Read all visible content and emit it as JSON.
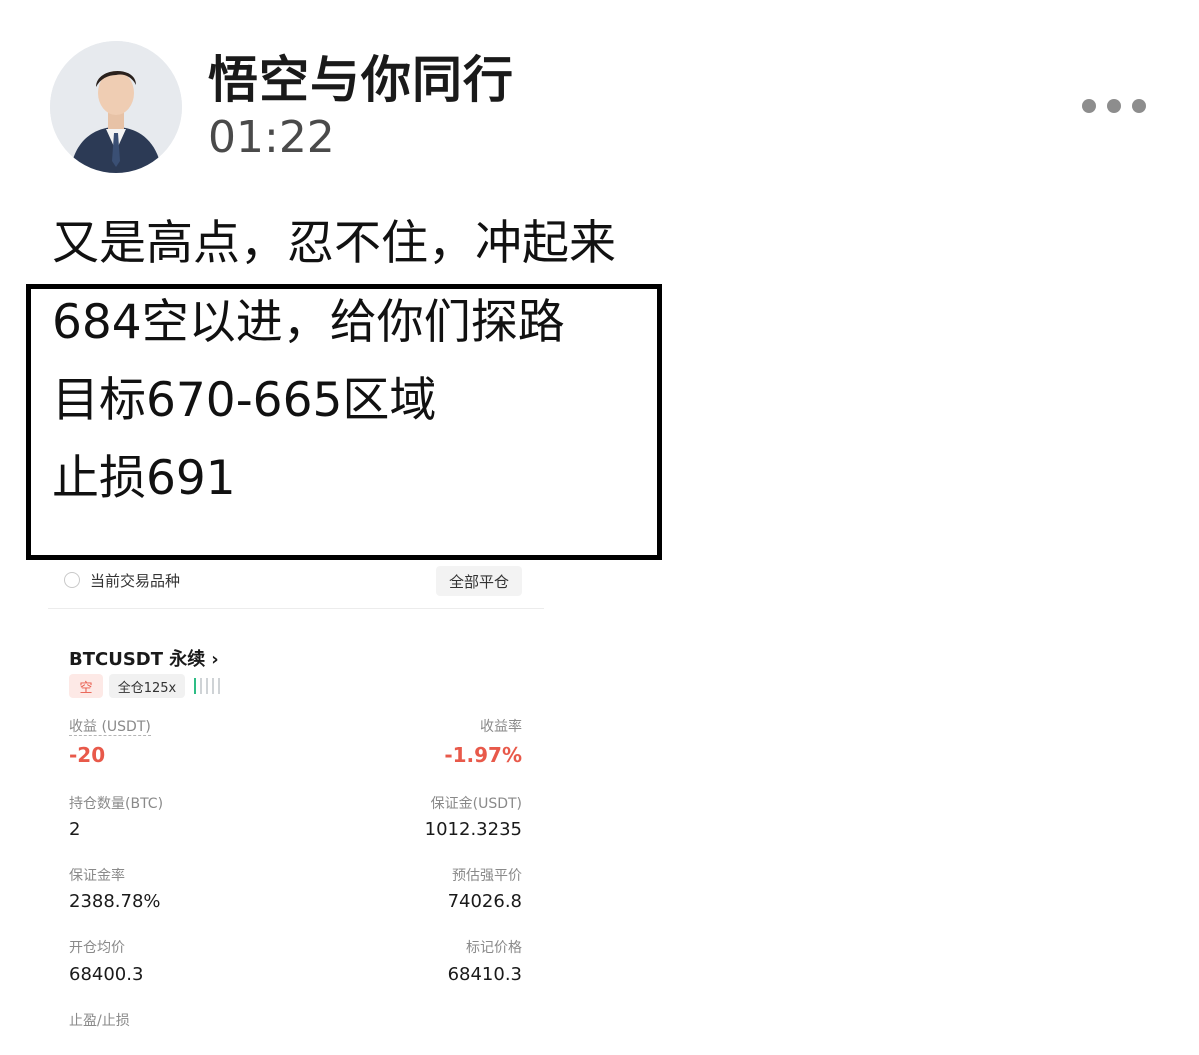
{
  "post": {
    "author": "悟空与你同行",
    "time": "01:22",
    "lines": [
      "又是高点，忍不住，冲起来",
      "684空以进，给你们探路",
      "目标670-665区域",
      "止损691"
    ]
  },
  "icons": {
    "more": "more-horizontal-icon",
    "avatar": "user-avatar"
  },
  "trade": {
    "filter_label": "当前交易品种",
    "close_all": "全部平仓",
    "symbol": "BTCUSDT 永续",
    "side": "空",
    "leverage": "全仓125x",
    "pnl_label": "收益 (USDT)",
    "pnl_value": "-20",
    "roe_label": "收益率",
    "roe_value": "-1.97%",
    "size_label": "持仓数量(BTC)",
    "size_value": "2",
    "margin_label": "保证金(USDT)",
    "margin_value": "1012.3235",
    "margin_ratio_label": "保证金率",
    "margin_ratio_value": "2388.78%",
    "liq_label": "预估强平价",
    "liq_value": "74026.8",
    "entry_label": "开仓均价",
    "entry_value": "68400.3",
    "mark_label": "标记价格",
    "mark_value": "68410.3",
    "tpsl_label": "止盈/止损",
    "colors": {
      "loss": "#e8594a",
      "bar_active": "#2ebd85",
      "bar_idle": "#cfd3d6"
    }
  }
}
